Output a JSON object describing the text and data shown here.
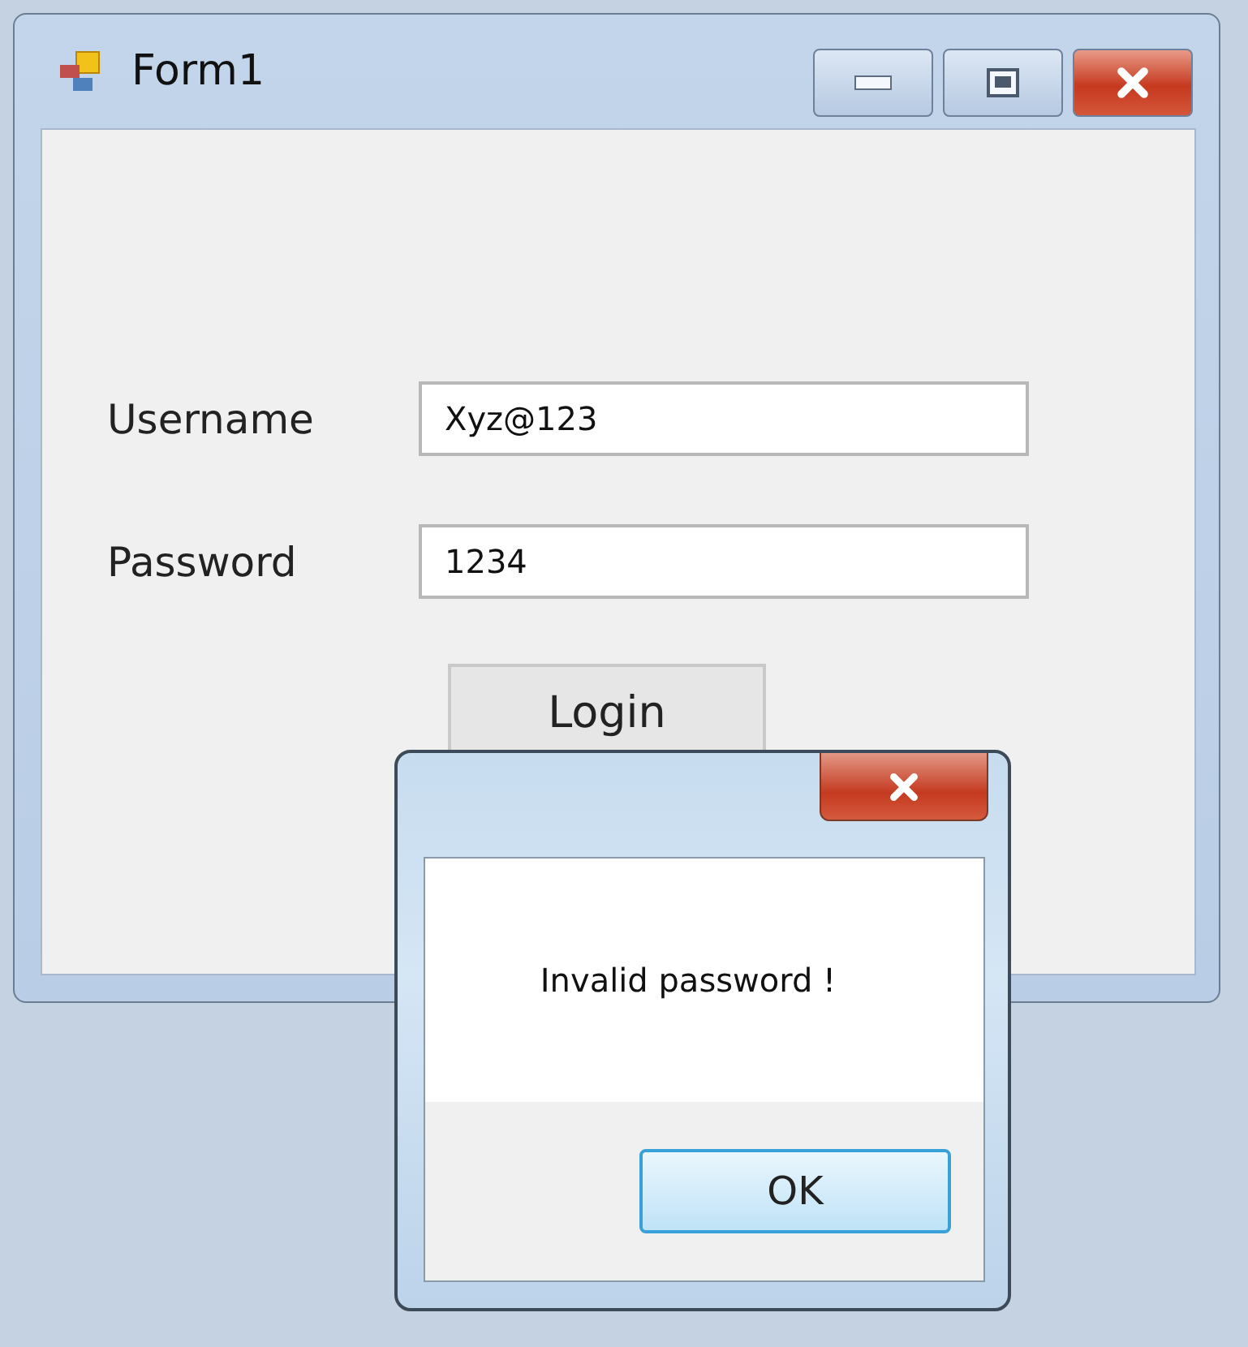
{
  "window": {
    "title": "Form1"
  },
  "fields": [
    {
      "label": "Username",
      "value": "Xyz@123"
    },
    {
      "label": "Password",
      "value": "1234"
    }
  ],
  "login_button": "Login",
  "message_box": {
    "message": "Invalid password !",
    "button": "OK"
  }
}
